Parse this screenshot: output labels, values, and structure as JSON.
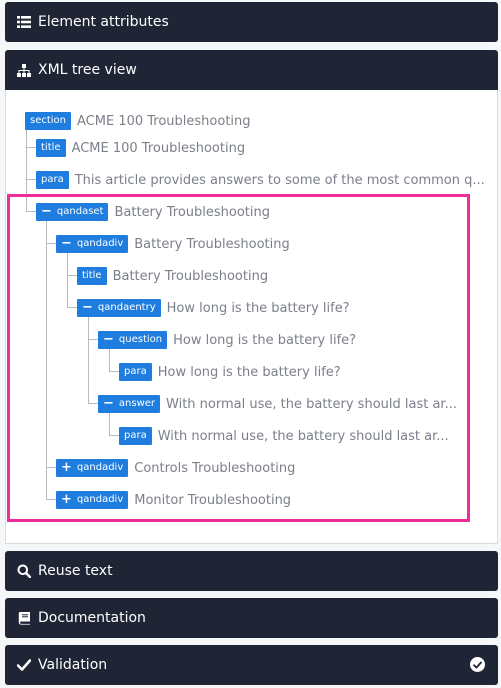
{
  "panels": {
    "element_attributes": "Element attributes",
    "xml_tree_view": "XML tree view",
    "reuse_text": "Reuse text",
    "documentation": "Documentation",
    "validation": "Validation"
  },
  "tree": {
    "n0": {
      "tag": "section",
      "toggle": "",
      "text": "ACME 100 Troubleshooting"
    },
    "n1": {
      "tag": "title",
      "toggle": "",
      "text": "ACME 100 Troubleshooting"
    },
    "n2": {
      "tag": "para",
      "toggle": "",
      "text": "This article provides answers to some of the most common q..."
    },
    "n3": {
      "tag": "qandaset",
      "toggle": "−",
      "text": "Battery Troubleshooting"
    },
    "n4": {
      "tag": "qandadiv",
      "toggle": "−",
      "text": "Battery Troubleshooting"
    },
    "n5": {
      "tag": "title",
      "toggle": "",
      "text": "Battery Troubleshooting"
    },
    "n6": {
      "tag": "qandaentry",
      "toggle": "−",
      "text": "How long is the battery life?"
    },
    "n7": {
      "tag": "question",
      "toggle": "−",
      "text": "How long is the battery life?"
    },
    "n8": {
      "tag": "para",
      "toggle": "",
      "text": "How long is the battery life?"
    },
    "n9": {
      "tag": "answer",
      "toggle": "−",
      "text": "With normal use, the battery should last ar..."
    },
    "n10": {
      "tag": "para",
      "toggle": "",
      "text": "With normal use, the battery should last ar..."
    },
    "n11": {
      "tag": "qandadiv",
      "toggle": "+",
      "text": "Controls Troubleshooting"
    },
    "n12": {
      "tag": "qandadiv",
      "toggle": "+",
      "text": "Monitor Troubleshooting"
    }
  },
  "icons": {
    "element_attributes": "list-icon",
    "xml_tree_view": "sitemap-icon",
    "reuse_text": "search-icon",
    "documentation": "book-icon",
    "validation": "check-icon",
    "validation_status": "check-circle-icon"
  },
  "colors": {
    "header_bg": "#1f2535",
    "badge_bg": "#1f7de0",
    "highlight": "#ee2c9b",
    "node_text": "#7b7f88"
  }
}
